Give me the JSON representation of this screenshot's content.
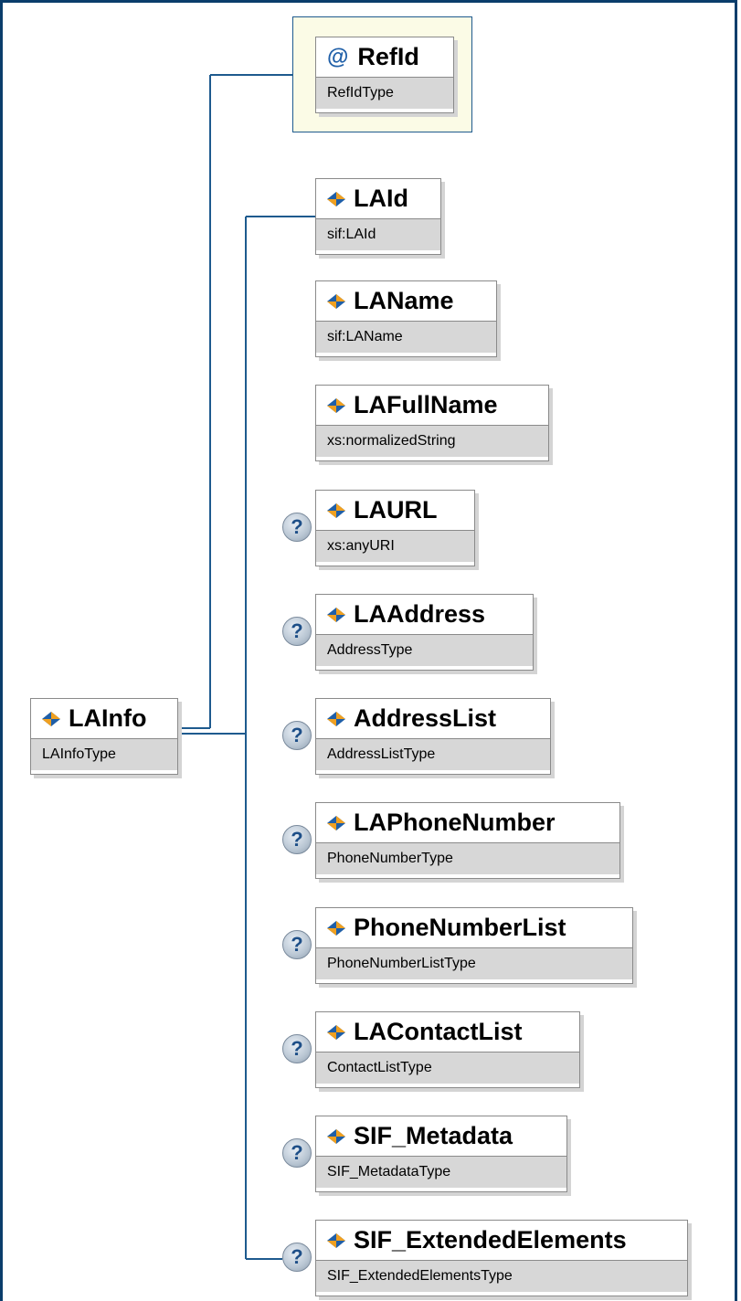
{
  "root": {
    "name": "LAInfo",
    "type": "LAInfoType",
    "icon": "element-icon"
  },
  "attribute": {
    "symbol": "@",
    "name": "RefId",
    "type": "RefIdType",
    "icon": "attribute-icon"
  },
  "children": [
    {
      "name": "LAId",
      "type": "sif:LAId",
      "optional": false
    },
    {
      "name": "LAName",
      "type": "sif:LAName",
      "optional": false
    },
    {
      "name": "LAFullName",
      "type": "xs:normalizedString",
      "optional": false
    },
    {
      "name": "LAURL",
      "type": "xs:anyURI",
      "optional": true
    },
    {
      "name": "LAAddress",
      "type": "AddressType",
      "optional": true
    },
    {
      "name": "AddressList",
      "type": "AddressListType",
      "optional": true
    },
    {
      "name": "LAPhoneNumber",
      "type": "PhoneNumberType",
      "optional": true
    },
    {
      "name": "PhoneNumberList",
      "type": "PhoneNumberListType",
      "optional": true
    },
    {
      "name": "LAContactList",
      "type": "ContactListType",
      "optional": true
    },
    {
      "name": "SIF_Metadata",
      "type": "SIF_MetadataType",
      "optional": true
    },
    {
      "name": "SIF_ExtendedElements",
      "type": "SIF_ExtendedElementsType",
      "optional": true
    }
  ],
  "optional_marker": "?",
  "colors": {
    "frame": "#0a3d6b",
    "connector": "#1e5a8e",
    "type_band": "#d7d7d7",
    "attribute_bg": "#fbfbe6",
    "icon_blue": "#1f5fa8",
    "icon_orange": "#f0a020"
  }
}
